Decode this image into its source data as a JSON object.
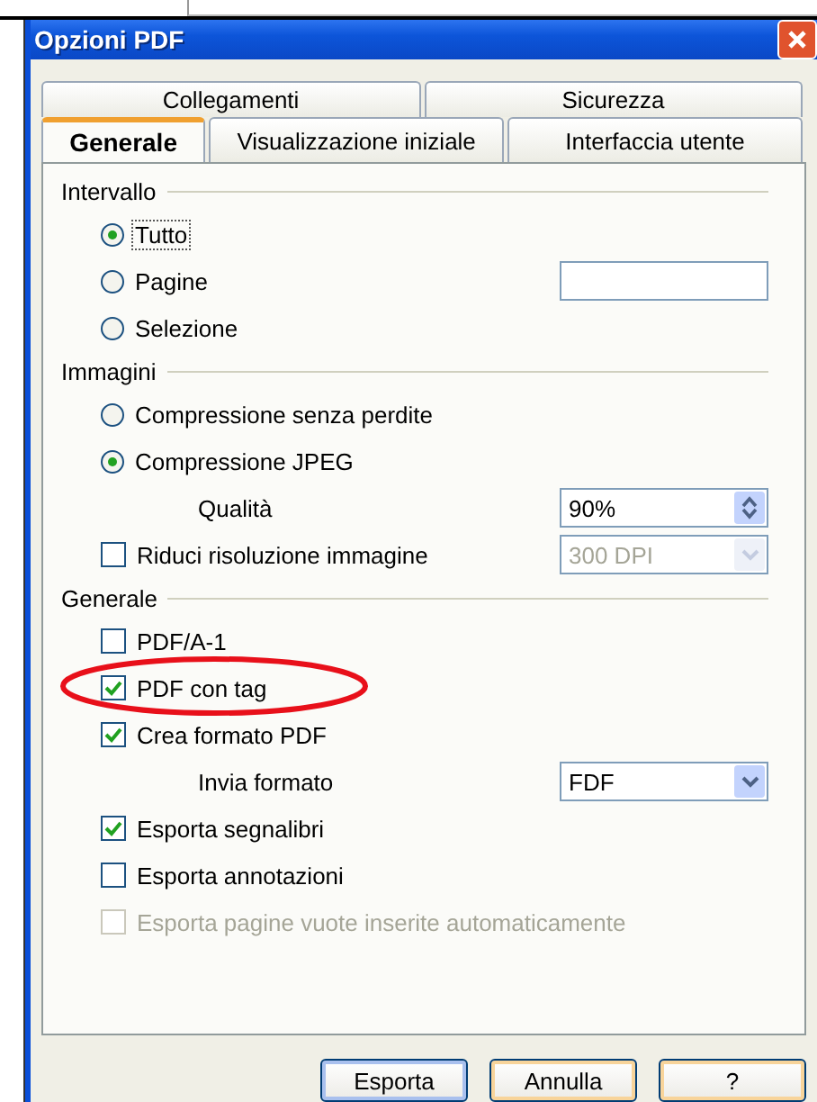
{
  "window": {
    "title": "Opzioni PDF"
  },
  "tab_rows": [
    [
      {
        "label": "Collegamenti",
        "selected": false
      },
      {
        "label": "Sicurezza",
        "selected": false
      }
    ],
    [
      {
        "label": "Generale",
        "selected": true
      },
      {
        "label": "Visualizzazione iniziale",
        "selected": false
      },
      {
        "label": "Interfaccia utente",
        "selected": false
      }
    ]
  ],
  "sections": [
    {
      "title": "Intervallo",
      "items": [
        {
          "kind": "radio",
          "label": "Tutto",
          "selected": true
        },
        {
          "kind": "radio",
          "label": "Pagine",
          "selected": false,
          "control": {
            "kind": "text"
          }
        },
        {
          "kind": "radio",
          "label": "Selezione",
          "selected": false
        }
      ]
    },
    {
      "title": "Immagini",
      "items": [
        {
          "kind": "radio",
          "label": "Compressione senza perdite",
          "selected": false
        },
        {
          "kind": "radio",
          "label": "Compressione JPEG",
          "selected": true
        },
        {
          "kind": "label",
          "label": "Qualità",
          "control": {
            "kind": "spin",
            "value": "90%",
            "disabled": false
          }
        },
        {
          "kind": "checkbox",
          "label": "Riduci risoluzione immagine",
          "checked": false,
          "disabled": false,
          "control": {
            "kind": "select",
            "value": "300 DPI",
            "disabled": true
          }
        }
      ]
    },
    {
      "title": "Generale",
      "items": [
        {
          "kind": "checkbox",
          "label": "PDF/A-1",
          "checked": false,
          "disabled": false
        },
        {
          "kind": "checkbox",
          "label": "PDF con tag",
          "checked": true,
          "disabled": false
        },
        {
          "kind": "checkbox",
          "label": "Crea formato PDF",
          "checked": true,
          "disabled": false
        },
        {
          "kind": "label",
          "label": "Invia formato",
          "control": {
            "kind": "select",
            "value": "FDF",
            "disabled": false
          }
        },
        {
          "kind": "checkbox",
          "label": "Esporta segnalibri",
          "checked": true,
          "disabled": false
        },
        {
          "kind": "checkbox",
          "label": "Esporta annotazioni",
          "checked": false,
          "disabled": false
        },
        {
          "kind": "checkbox",
          "label": "Esporta pagine vuote inserite automaticamente",
          "checked": false,
          "disabled": true
        }
      ]
    }
  ],
  "buttons": [
    "Esporta",
    "Annulla",
    "?"
  ]
}
